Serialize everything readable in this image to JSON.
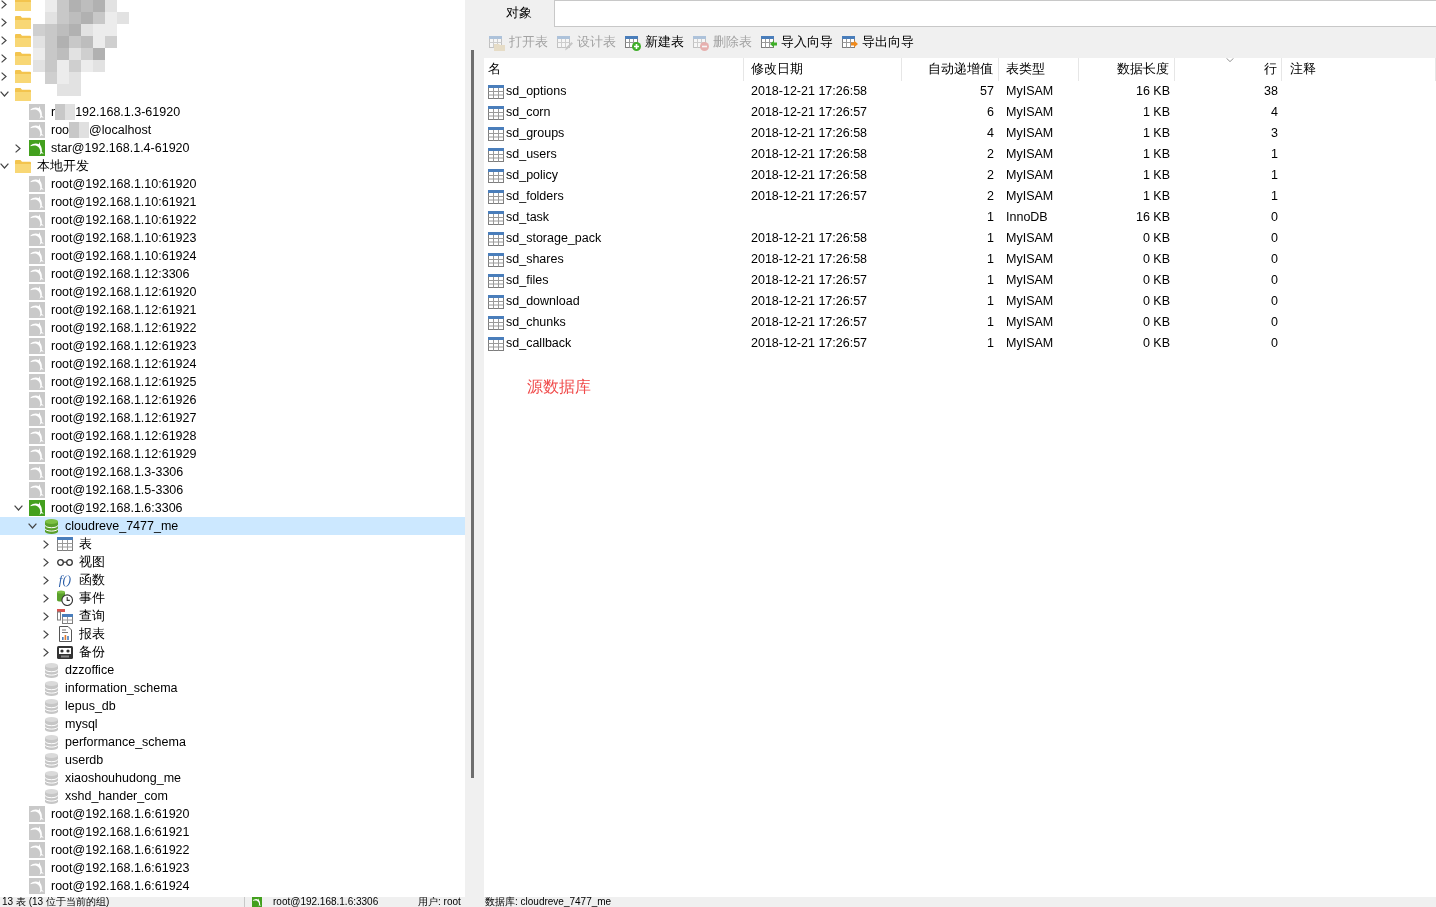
{
  "tree": [
    {
      "kind": "folder",
      "expanded": false,
      "selected": false
    },
    {
      "kind": "folder",
      "expanded": false,
      "selected": false
    },
    {
      "kind": "folder",
      "expanded": false,
      "selected": false
    },
    {
      "kind": "folder",
      "expanded": false,
      "selected": false
    },
    {
      "kind": "folder",
      "expanded": false,
      "selected": false
    },
    {
      "kind": "folder",
      "expanded": true,
      "selected": false,
      "children": [
        {
          "kind": "connection",
          "connected": false,
          "selected": false,
          "label": "r",
          "label_after_redaction": "192.168.1.3-61920"
        },
        {
          "kind": "connection",
          "connected": false,
          "selected": false,
          "label": "roo",
          "label_after_redaction": "@localhost"
        },
        {
          "kind": "connection",
          "connected": true,
          "expanded": false,
          "selected": false,
          "label": "star@192.168.1.4-61920"
        }
      ]
    },
    {
      "kind": "folder",
      "label": "本地开发",
      "expanded": true,
      "selected": false,
      "children": [
        {
          "kind": "connection",
          "connected": false,
          "selected": false,
          "label": "root@192.168.1.10:61920"
        },
        {
          "kind": "connection",
          "connected": false,
          "selected": false,
          "label": "root@192.168.1.10:61921"
        },
        {
          "kind": "connection",
          "connected": false,
          "selected": false,
          "label": "root@192.168.1.10:61922"
        },
        {
          "kind": "connection",
          "connected": false,
          "selected": false,
          "label": "root@192.168.1.10:61923"
        },
        {
          "kind": "connection",
          "connected": false,
          "selected": false,
          "label": "root@192.168.1.10:61924"
        },
        {
          "kind": "connection",
          "connected": false,
          "selected": false,
          "label": "root@192.168.1.12:3306"
        },
        {
          "kind": "connection",
          "connected": false,
          "selected": false,
          "label": "root@192.168.1.12:61920"
        },
        {
          "kind": "connection",
          "connected": false,
          "selected": false,
          "label": "root@192.168.1.12:61921"
        },
        {
          "kind": "connection",
          "connected": false,
          "selected": false,
          "label": "root@192.168.1.12:61922"
        },
        {
          "kind": "connection",
          "connected": false,
          "selected": false,
          "label": "root@192.168.1.12:61923"
        },
        {
          "kind": "connection",
          "connected": false,
          "selected": false,
          "label": "root@192.168.1.12:61924"
        },
        {
          "kind": "connection",
          "connected": false,
          "selected": false,
          "label": "root@192.168.1.12:61925"
        },
        {
          "kind": "connection",
          "connected": false,
          "selected": false,
          "label": "root@192.168.1.12:61926"
        },
        {
          "kind": "connection",
          "connected": false,
          "selected": false,
          "label": "root@192.168.1.12:61927"
        },
        {
          "kind": "connection",
          "connected": false,
          "selected": false,
          "label": "root@192.168.1.12:61928"
        },
        {
          "kind": "connection",
          "connected": false,
          "selected": false,
          "label": "root@192.168.1.12:61929"
        },
        {
          "kind": "connection",
          "connected": false,
          "selected": false,
          "label": "root@192.168.1.3-3306"
        },
        {
          "kind": "connection",
          "connected": false,
          "selected": false,
          "label": "root@192.168.1.5-3306"
        },
        {
          "kind": "connection",
          "connected": true,
          "expanded": true,
          "selected": false,
          "label": "root@192.168.1.6:3306",
          "children": [
            {
              "kind": "database",
              "open": true,
              "expanded": true,
              "selected": true,
              "label": "cloudreve_7477_me",
              "children": [
                {
                  "kind": "tables",
                  "expanded": false,
                  "selected": false,
                  "label": "表"
                },
                {
                  "kind": "views",
                  "expanded": false,
                  "selected": false,
                  "label": "视图"
                },
                {
                  "kind": "functions",
                  "expanded": false,
                  "selected": false,
                  "icon_text": "f()",
                  "label": "函数"
                },
                {
                  "kind": "events",
                  "expanded": false,
                  "selected": false,
                  "label": "事件"
                },
                {
                  "kind": "queries",
                  "expanded": false,
                  "selected": false,
                  "label": "查询"
                },
                {
                  "kind": "reports",
                  "expanded": false,
                  "selected": false,
                  "label": "报表"
                },
                {
                  "kind": "backups",
                  "expanded": false,
                  "selected": false,
                  "label": "备份"
                }
              ]
            },
            {
              "kind": "database",
              "open": false,
              "selected": false,
              "label": "dzzoffice"
            },
            {
              "kind": "database",
              "open": false,
              "selected": false,
              "label": "information_schema"
            },
            {
              "kind": "database",
              "open": false,
              "selected": false,
              "label": "lepus_db"
            },
            {
              "kind": "database",
              "open": false,
              "selected": false,
              "label": "mysql"
            },
            {
              "kind": "database",
              "open": false,
              "selected": false,
              "label": "performance_schema"
            },
            {
              "kind": "database",
              "open": false,
              "selected": false,
              "label": "userdb"
            },
            {
              "kind": "database",
              "open": false,
              "selected": false,
              "label": "xiaoshouhudong_me"
            },
            {
              "kind": "database",
              "open": false,
              "selected": false,
              "label": "xshd_hander_com"
            }
          ]
        },
        {
          "kind": "connection",
          "connected": false,
          "selected": false,
          "label": "root@192.168.1.6:61920"
        },
        {
          "kind": "connection",
          "connected": false,
          "selected": false,
          "label": "root@192.168.1.6:61921"
        },
        {
          "kind": "connection",
          "connected": false,
          "selected": false,
          "label": "root@192.168.1.6:61922"
        },
        {
          "kind": "connection",
          "connected": false,
          "selected": false,
          "label": "root@192.168.1.6:61923"
        },
        {
          "kind": "connection",
          "connected": false,
          "selected": false,
          "label": "root@192.168.1.6:61924"
        }
      ]
    }
  ],
  "tabs": [
    {
      "label": "对象",
      "selected": true
    }
  ],
  "toolbar": [
    {
      "kind": "open",
      "label": "打开表",
      "disabled": true
    },
    {
      "kind": "design",
      "label": "设计表",
      "disabled": true
    },
    {
      "kind": "new",
      "label": "新建表",
      "disabled": false
    },
    {
      "kind": "delete",
      "label": "删除表",
      "disabled": true
    },
    {
      "kind": "import",
      "label": "导入向导",
      "disabled": false
    },
    {
      "kind": "export",
      "label": "导出向导",
      "disabled": false
    }
  ],
  "table": {
    "columns": [
      {
        "label": "名",
        "kind": "text",
        "sorted": false
      },
      {
        "label": "修改日期",
        "kind": "text",
        "sorted": false
      },
      {
        "label": "自动递增值",
        "kind": "number",
        "sorted": false
      },
      {
        "label": "表类型",
        "kind": "text",
        "sorted": false
      },
      {
        "label": "数据长度",
        "kind": "number",
        "sorted": false
      },
      {
        "label": "行",
        "kind": "number",
        "sorted": true
      },
      {
        "label": "注释",
        "kind": "text",
        "sorted": false
      }
    ],
    "rows": [
      {
        "name": "sd_options",
        "modified": "2018-12-21 17:26:58",
        "auto_increment": "57",
        "engine": "MyISAM",
        "data_length": "16 KB",
        "rows": "38"
      },
      {
        "name": "sd_corn",
        "modified": "2018-12-21 17:26:57",
        "auto_increment": "6",
        "engine": "MyISAM",
        "data_length": "1 KB",
        "rows": "4"
      },
      {
        "name": "sd_groups",
        "modified": "2018-12-21 17:26:58",
        "auto_increment": "4",
        "engine": "MyISAM",
        "data_length": "1 KB",
        "rows": "3"
      },
      {
        "name": "sd_users",
        "modified": "2018-12-21 17:26:58",
        "auto_increment": "2",
        "engine": "MyISAM",
        "data_length": "1 KB",
        "rows": "1"
      },
      {
        "name": "sd_policy",
        "modified": "2018-12-21 17:26:58",
        "auto_increment": "2",
        "engine": "MyISAM",
        "data_length": "1 KB",
        "rows": "1"
      },
      {
        "name": "sd_folders",
        "modified": "2018-12-21 17:26:57",
        "auto_increment": "2",
        "engine": "MyISAM",
        "data_length": "1 KB",
        "rows": "1"
      },
      {
        "name": "sd_task",
        "auto_increment": "1",
        "engine": "InnoDB",
        "data_length": "16 KB",
        "rows": "0"
      },
      {
        "name": "sd_storage_pack",
        "modified": "2018-12-21 17:26:58",
        "auto_increment": "1",
        "engine": "MyISAM",
        "data_length": "0 KB",
        "rows": "0"
      },
      {
        "name": "sd_shares",
        "modified": "2018-12-21 17:26:58",
        "auto_increment": "1",
        "engine": "MyISAM",
        "data_length": "0 KB",
        "rows": "0"
      },
      {
        "name": "sd_files",
        "modified": "2018-12-21 17:26:57",
        "auto_increment": "1",
        "engine": "MyISAM",
        "data_length": "0 KB",
        "rows": "0"
      },
      {
        "name": "sd_download",
        "modified": "2018-12-21 17:26:57",
        "auto_increment": "1",
        "engine": "MyISAM",
        "data_length": "0 KB",
        "rows": "0"
      },
      {
        "name": "sd_chunks",
        "modified": "2018-12-21 17:26:57",
        "auto_increment": "1",
        "engine": "MyISAM",
        "data_length": "0 KB",
        "rows": "0"
      },
      {
        "name": "sd_callback",
        "modified": "2018-12-21 17:26:57",
        "auto_increment": "1",
        "engine": "MyISAM",
        "data_length": "0 KB",
        "rows": "0"
      }
    ]
  },
  "annotation": "源数据库",
  "status_bar": {
    "summary": "13 表 (13 位于当前的组)",
    "connection": "root@192.168.1.6:3306",
    "user": "用户: root",
    "database": "数据库: cloudreve_7477_me"
  }
}
